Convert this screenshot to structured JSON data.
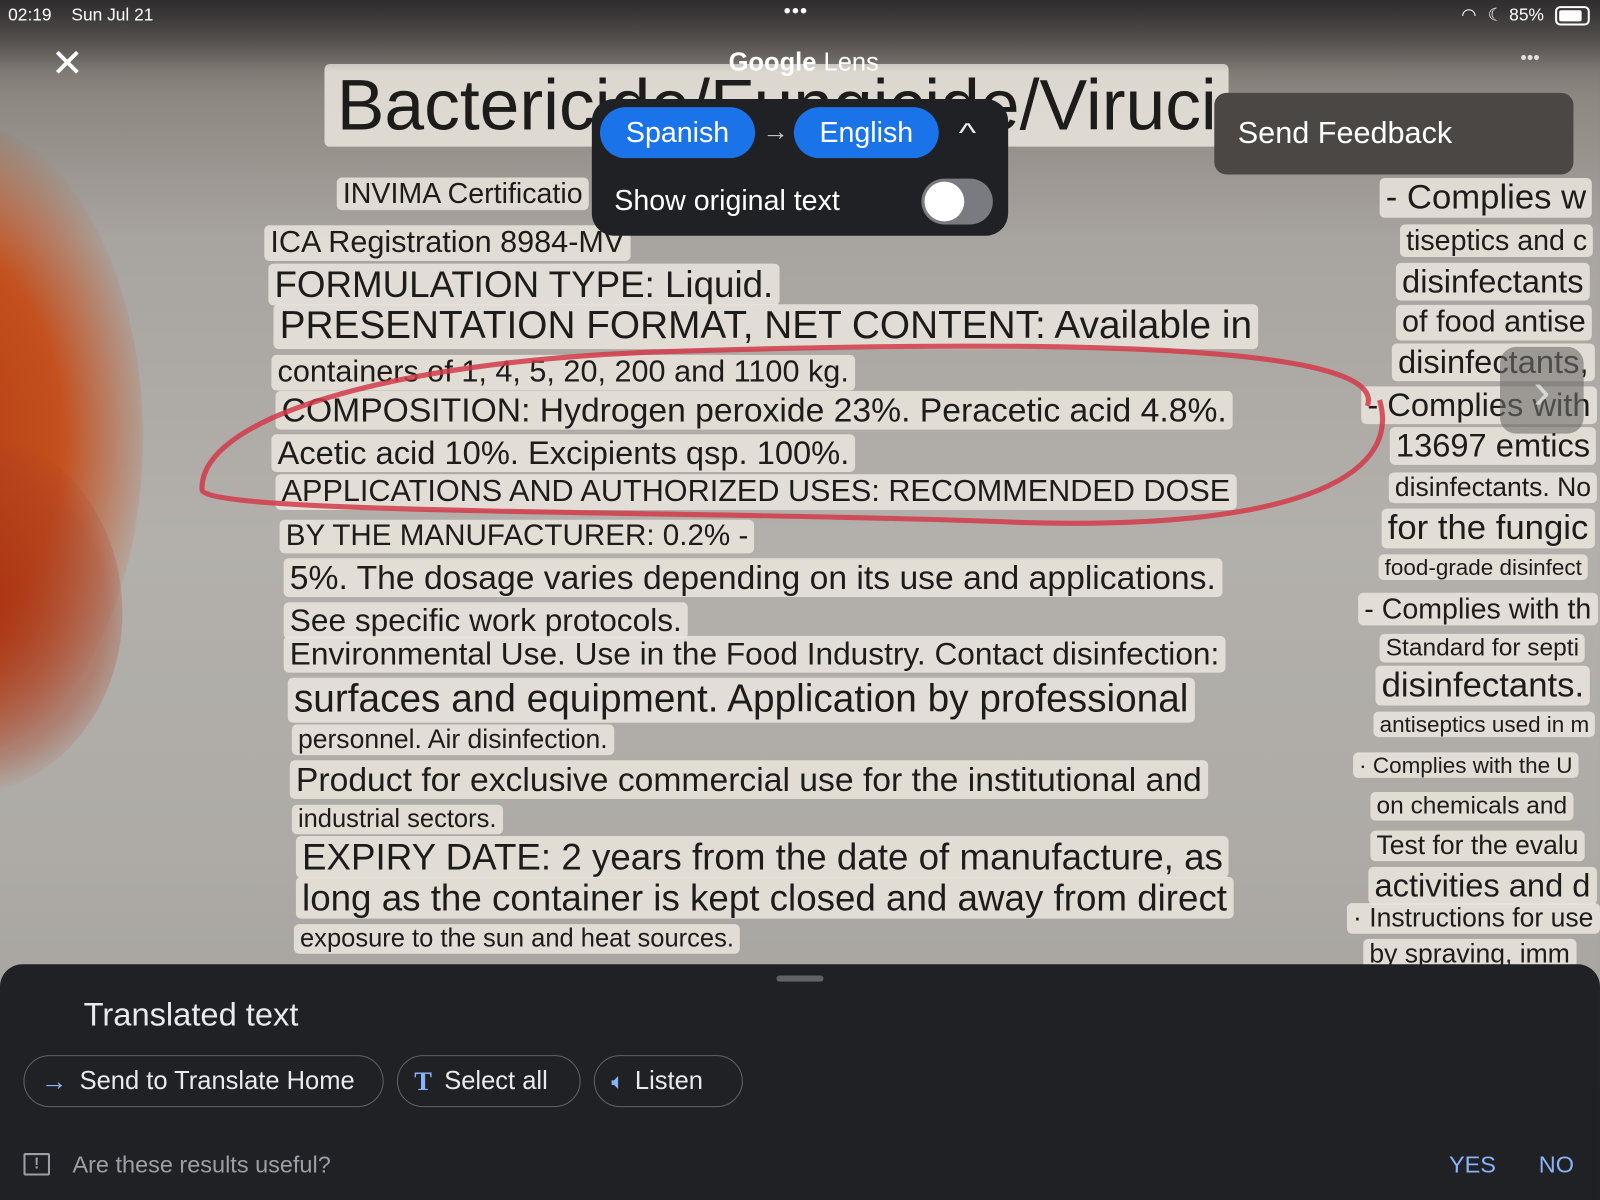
{
  "status_bar": {
    "time": "02:19",
    "date": "Sun Jul 21",
    "battery": "85%"
  },
  "header": {
    "title_google": "Google",
    "title_lens": "Lens",
    "close_icon": "close-icon",
    "more_icon": "more-horizontal-icon"
  },
  "translate_popup": {
    "source_language": "Spanish",
    "target_language": "English",
    "show_original_label": "Show original text",
    "show_original_enabled": false,
    "accent": "#1a73e8"
  },
  "menu": {
    "send_feedback": "Send Feedback"
  },
  "document": {
    "title": "Bactericide/Fungicide/Viruci",
    "left_lines": [
      "INVIMA Certificatio",
      "ICA Registration 8984-MV",
      "FORMULATION TYPE: Liquid.",
      "PRESENTATION FORMAT, NET CONTENT: Available in",
      "containers of 1, 4, 5, 20, 200 and 1100 kg.",
      "COMPOSITION: Hydrogen peroxide 23%. Peracetic acid 4.8%.",
      "Acetic acid 10%. Excipients qsp. 100%.",
      "APPLICATIONS AND AUTHORIZED USES: RECOMMENDED DOSE",
      "BY THE MANUFACTURER: 0.2% -",
      "5%. The dosage varies depending on its use and applications.",
      "See specific work protocols.",
      "Environmental Use. Use in the Food Industry. Contact disinfection:",
      "surfaces and equipment. Application by professional",
      "personnel. Air disinfection.",
      "Product for exclusive commercial use for the institutional and",
      "industrial sectors.",
      "EXPIRY DATE: 2 years from the date of manufacture, as",
      "long as the container is kept closed and away from direct",
      "exposure to the sun and heat sources."
    ],
    "right_lines": [
      "- Complies w",
      "tiseptics and c",
      "disinfectants",
      "of food antise",
      "disinfectants,",
      "- Complies with",
      "13697 emtics",
      "disinfectants. No",
      "for the fungic",
      "food-grade disinfect",
      "- Complies with th",
      "Standard for septi",
      "disinfectants.",
      "antiseptics used in m",
      "· Complies with the U",
      "on chemicals and",
      "Test for the evalu",
      "activities and d",
      "· Instructions for use",
      "by spraving, imm"
    ],
    "annotation_color": "#d23a4a"
  },
  "bottom_panel": {
    "heading": "Translated text",
    "actions": [
      {
        "label": "Send to Translate Home",
        "icon": "arrow-right-icon"
      },
      {
        "label": "Select all",
        "icon": "text-icon"
      },
      {
        "label": "Listen",
        "icon": "speaker-icon"
      }
    ],
    "feedback_question": "Are these results useful?",
    "yes": "YES",
    "no": "NO"
  }
}
